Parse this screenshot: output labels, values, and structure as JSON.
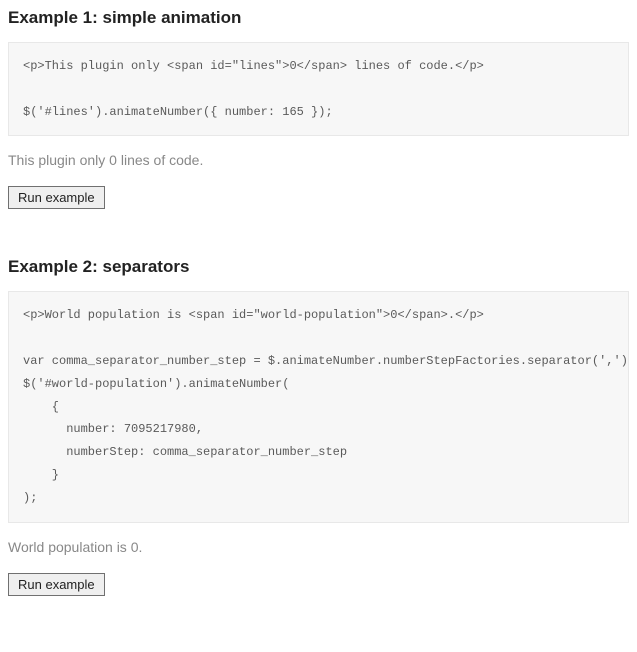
{
  "example1": {
    "heading": "Example 1: simple animation",
    "code": "<p>This plugin only <span id=\"lines\">0</span> lines of code.</p>\n\n$('#lines').animateNumber({ number: 165 });",
    "output_prefix": "This plugin only ",
    "output_value": "0",
    "output_suffix": " lines of code.",
    "button_label": "Run example"
  },
  "example2": {
    "heading": "Example 2: separators",
    "code": "<p>World population is <span id=\"world-population\">0</span>.</p>\n\nvar comma_separator_number_step = $.animateNumber.numberStepFactories.separator(',')\n$('#world-population').animateNumber(\n    {\n      number: 7095217980,\n      numberStep: comma_separator_number_step\n    }\n);",
    "output_prefix": "World population is ",
    "output_value": "0",
    "output_suffix": ".",
    "button_label": "Run example"
  }
}
